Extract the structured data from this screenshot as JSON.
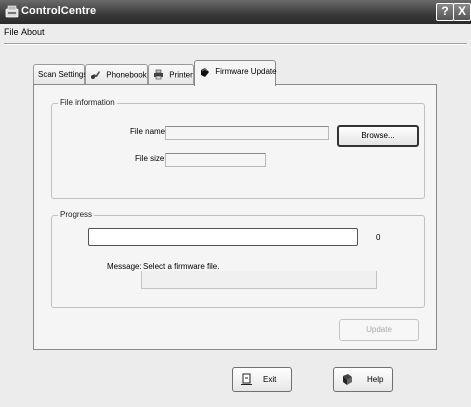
{
  "window": {
    "title": "ControlCentre",
    "help_glyph": "?",
    "close_glyph": "X"
  },
  "menu": {
    "items": [
      "File",
      "About"
    ]
  },
  "tabs": [
    {
      "label": "Scan Settings",
      "icon": null,
      "active": false
    },
    {
      "label": "Phonebook",
      "icon": "phonebook-icon",
      "active": false
    },
    {
      "label": "Printer",
      "icon": "printer-icon",
      "active": false
    },
    {
      "label": "Firmware Update",
      "icon": "firmware-icon",
      "active": true
    }
  ],
  "file_info": {
    "group_title": "File information",
    "file_name_label": "File name:",
    "file_name_value": "",
    "file_size_label": "File size:",
    "file_size_value": "",
    "browse_label": "Browse..."
  },
  "progress": {
    "group_title": "Progress",
    "value_text": "0",
    "percent": 0,
    "message_label": "Message:",
    "message_text": "Select a firmware file."
  },
  "update_label": "Update",
  "footer": {
    "exit_label": "Exit",
    "help_label": "Help"
  }
}
